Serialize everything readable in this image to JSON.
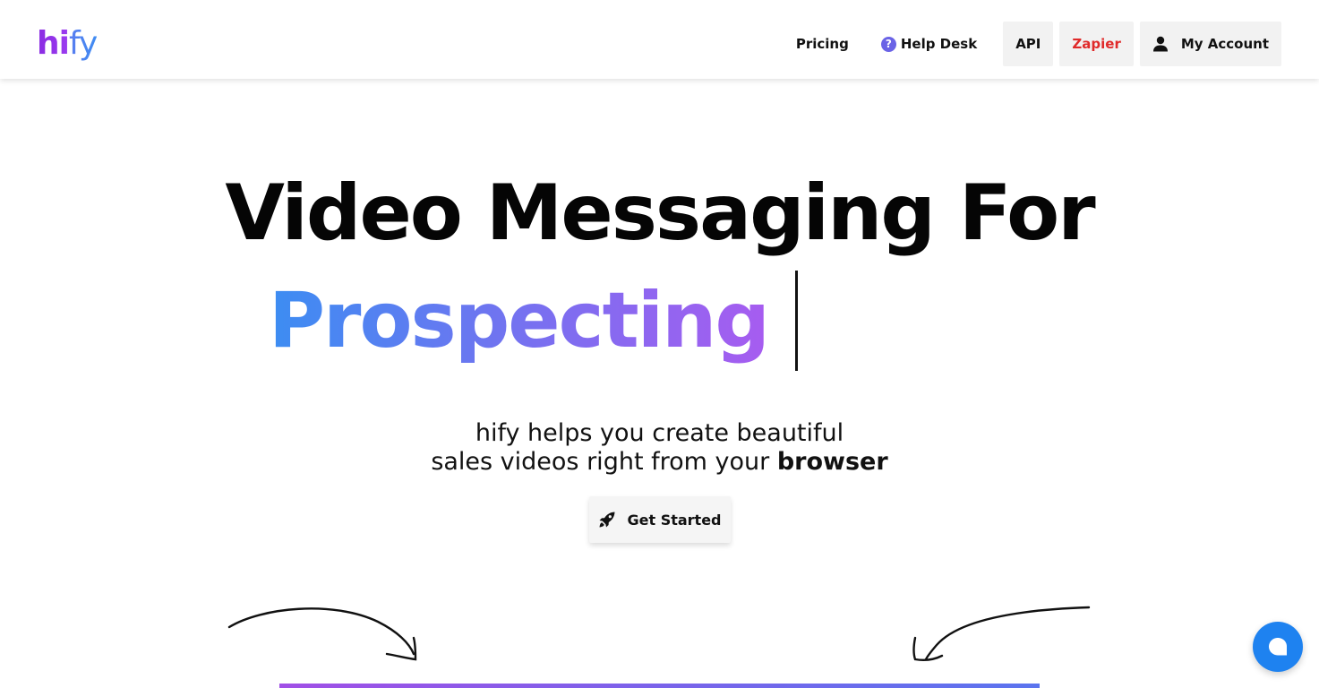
{
  "header": {
    "logo": {
      "part1": "hi",
      "part2": "fy"
    },
    "nav": {
      "pricing": "Pricing",
      "help_desk": "Help Desk",
      "api": "API",
      "zapier": "Zapier",
      "my_account": "My Account"
    }
  },
  "hero": {
    "title": "Video Messaging For",
    "rotating_word": "Prospecting",
    "subtitle_line1": "hify helps you create beautiful",
    "subtitle_line2_prefix": "sales videos right from your ",
    "subtitle_line2_bold": "browser",
    "cta_label": "Get Started"
  },
  "colors": {
    "brand_purple": "#8a2be2",
    "brand_blue": "#3f8cf2",
    "zapier_red": "#e02a2a",
    "chat_blue": "#1e82f0"
  },
  "icons": {
    "help": "question-circle-icon",
    "account": "user-icon",
    "cta": "rocket-icon",
    "chat": "chat-bubble-icon"
  }
}
